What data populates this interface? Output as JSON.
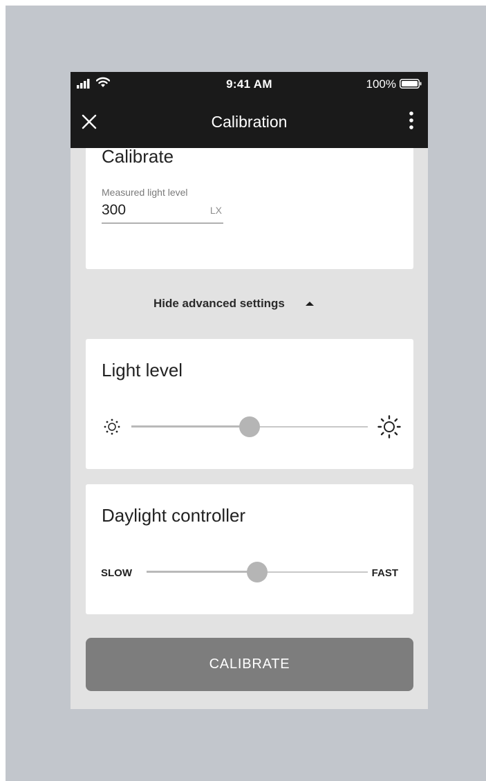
{
  "status_bar": {
    "time": "9:41 AM",
    "battery": "100%",
    "icons": [
      "cellular-signal-icon",
      "wifi-icon",
      "battery-icon"
    ]
  },
  "app_bar": {
    "title": "Calibration",
    "icons": [
      "close-icon",
      "more-vertical-icon"
    ]
  },
  "calibrate_card": {
    "title": "Calibrate",
    "field_label": "Measured light level",
    "value": "300",
    "unit": "LX"
  },
  "advanced_toggle": {
    "label": "Hide advanced settings",
    "icon": "caret-up-icon"
  },
  "light_level": {
    "title": "Light level",
    "value_fraction": 0.5,
    "min_icon": "sun-small-icon",
    "max_icon": "sun-large-icon"
  },
  "daylight_controller": {
    "title": "Daylight controller",
    "min_label": "SLOW",
    "max_label": "FAST",
    "value_fraction": 0.5
  },
  "primary_button": {
    "label": "CALIBRATE"
  },
  "colors": {
    "app_bar": "#1a1a1a",
    "screen_background": "#e2e2e2",
    "card": "#ffffff",
    "button": "#7d7d7d",
    "slider_thumb": "#b5b5b5"
  }
}
